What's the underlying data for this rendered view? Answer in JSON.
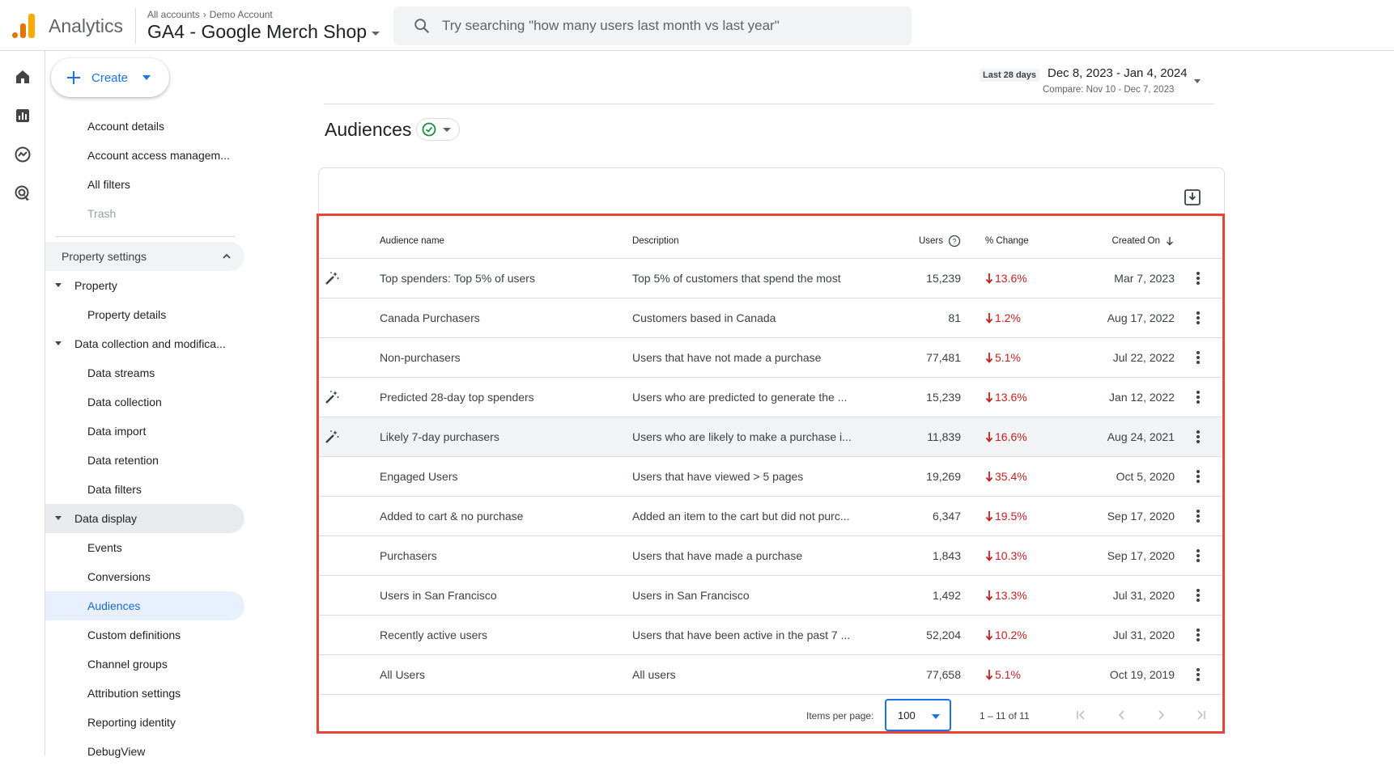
{
  "app": {
    "name": "Analytics"
  },
  "breadcrumb": {
    "level1": "All accounts",
    "level2": "Demo Account"
  },
  "property": {
    "name": "GA4 - Google Merch Shop"
  },
  "search": {
    "placeholder": "Try searching \"how many users last month vs last year\""
  },
  "rail": {
    "icons": [
      "home-icon",
      "reports-icon",
      "explore-icon",
      "advertising-icon"
    ]
  },
  "create": {
    "label": "Create"
  },
  "nav": {
    "account_items": [
      "Account details",
      "Account access managem...",
      "All filters",
      "Trash"
    ],
    "property_settings": "Property settings",
    "property_group": "Property",
    "property_items": [
      "Property details"
    ],
    "data_collection_group": "Data collection and modifica...",
    "data_collection_items": [
      "Data streams",
      "Data collection",
      "Data import",
      "Data retention",
      "Data filters"
    ],
    "data_display_group": "Data display",
    "data_display_items": [
      "Events",
      "Conversions",
      "Audiences",
      "Custom definitions",
      "Channel groups",
      "Attribution settings",
      "Reporting identity",
      "DebugView"
    ]
  },
  "date": {
    "tag": "Last 28 days",
    "range": "Dec 8, 2023 - Jan 4, 2024",
    "compare": "Compare: Nov 10 - Dec 7, 2023"
  },
  "page": {
    "title": "Audiences"
  },
  "table": {
    "headers": {
      "name": "Audience name",
      "description": "Description",
      "users": "Users",
      "change": "% Change",
      "created": "Created On"
    },
    "rows": [
      {
        "predictive": true,
        "name": "Top spenders: Top 5% of users",
        "description": "Top 5% of customers that spend the most",
        "users": "15,239",
        "change": "13.6%",
        "created": "Mar 7, 2023"
      },
      {
        "predictive": false,
        "name": "Canada Purchasers",
        "description": "Customers based in Canada",
        "users": "81",
        "change": "1.2%",
        "created": "Aug 17, 2022"
      },
      {
        "predictive": false,
        "name": "Non-purchasers",
        "description": "Users that have not made a purchase",
        "users": "77,481",
        "change": "5.1%",
        "created": "Jul 22, 2022"
      },
      {
        "predictive": true,
        "name": "Predicted 28-day top spenders",
        "description": "Users who are predicted to generate the ...",
        "users": "15,239",
        "change": "13.6%",
        "created": "Jan 12, 2022"
      },
      {
        "predictive": true,
        "name": "Likely 7-day purchasers",
        "description": "Users who are likely to make a purchase i...",
        "users": "11,839",
        "change": "16.6%",
        "created": "Aug 24, 2021"
      },
      {
        "predictive": false,
        "name": "Engaged Users",
        "description": "Users that have viewed > 5 pages",
        "users": "19,269",
        "change": "35.4%",
        "created": "Oct 5, 2020"
      },
      {
        "predictive": false,
        "name": "Added to cart & no purchase",
        "description": "Added an item to the cart but did not purc...",
        "users": "6,347",
        "change": "19.5%",
        "created": "Sep 17, 2020"
      },
      {
        "predictive": false,
        "name": "Purchasers",
        "description": "Users that have made a purchase",
        "users": "1,843",
        "change": "10.3%",
        "created": "Sep 17, 2020"
      },
      {
        "predictive": false,
        "name": "Users in San Francisco",
        "description": "Users in San Francisco",
        "users": "1,492",
        "change": "13.3%",
        "created": "Jul 31, 2020"
      },
      {
        "predictive": false,
        "name": "Recently active users",
        "description": "Users that have been active in the past 7 ...",
        "users": "52,204",
        "change": "10.2%",
        "created": "Jul 31, 2020"
      },
      {
        "predictive": false,
        "name": "All Users",
        "description": "All users",
        "users": "77,658",
        "change": "5.1%",
        "created": "Oct 19, 2019"
      }
    ]
  },
  "pagination": {
    "items_per_page_label": "Items per page:",
    "items_per_page": "100",
    "range": "1 – 11 of 11"
  },
  "colors": {
    "accent": "#1a73e8",
    "negative": "#c5221f",
    "highlight_box": "#ea4335"
  }
}
